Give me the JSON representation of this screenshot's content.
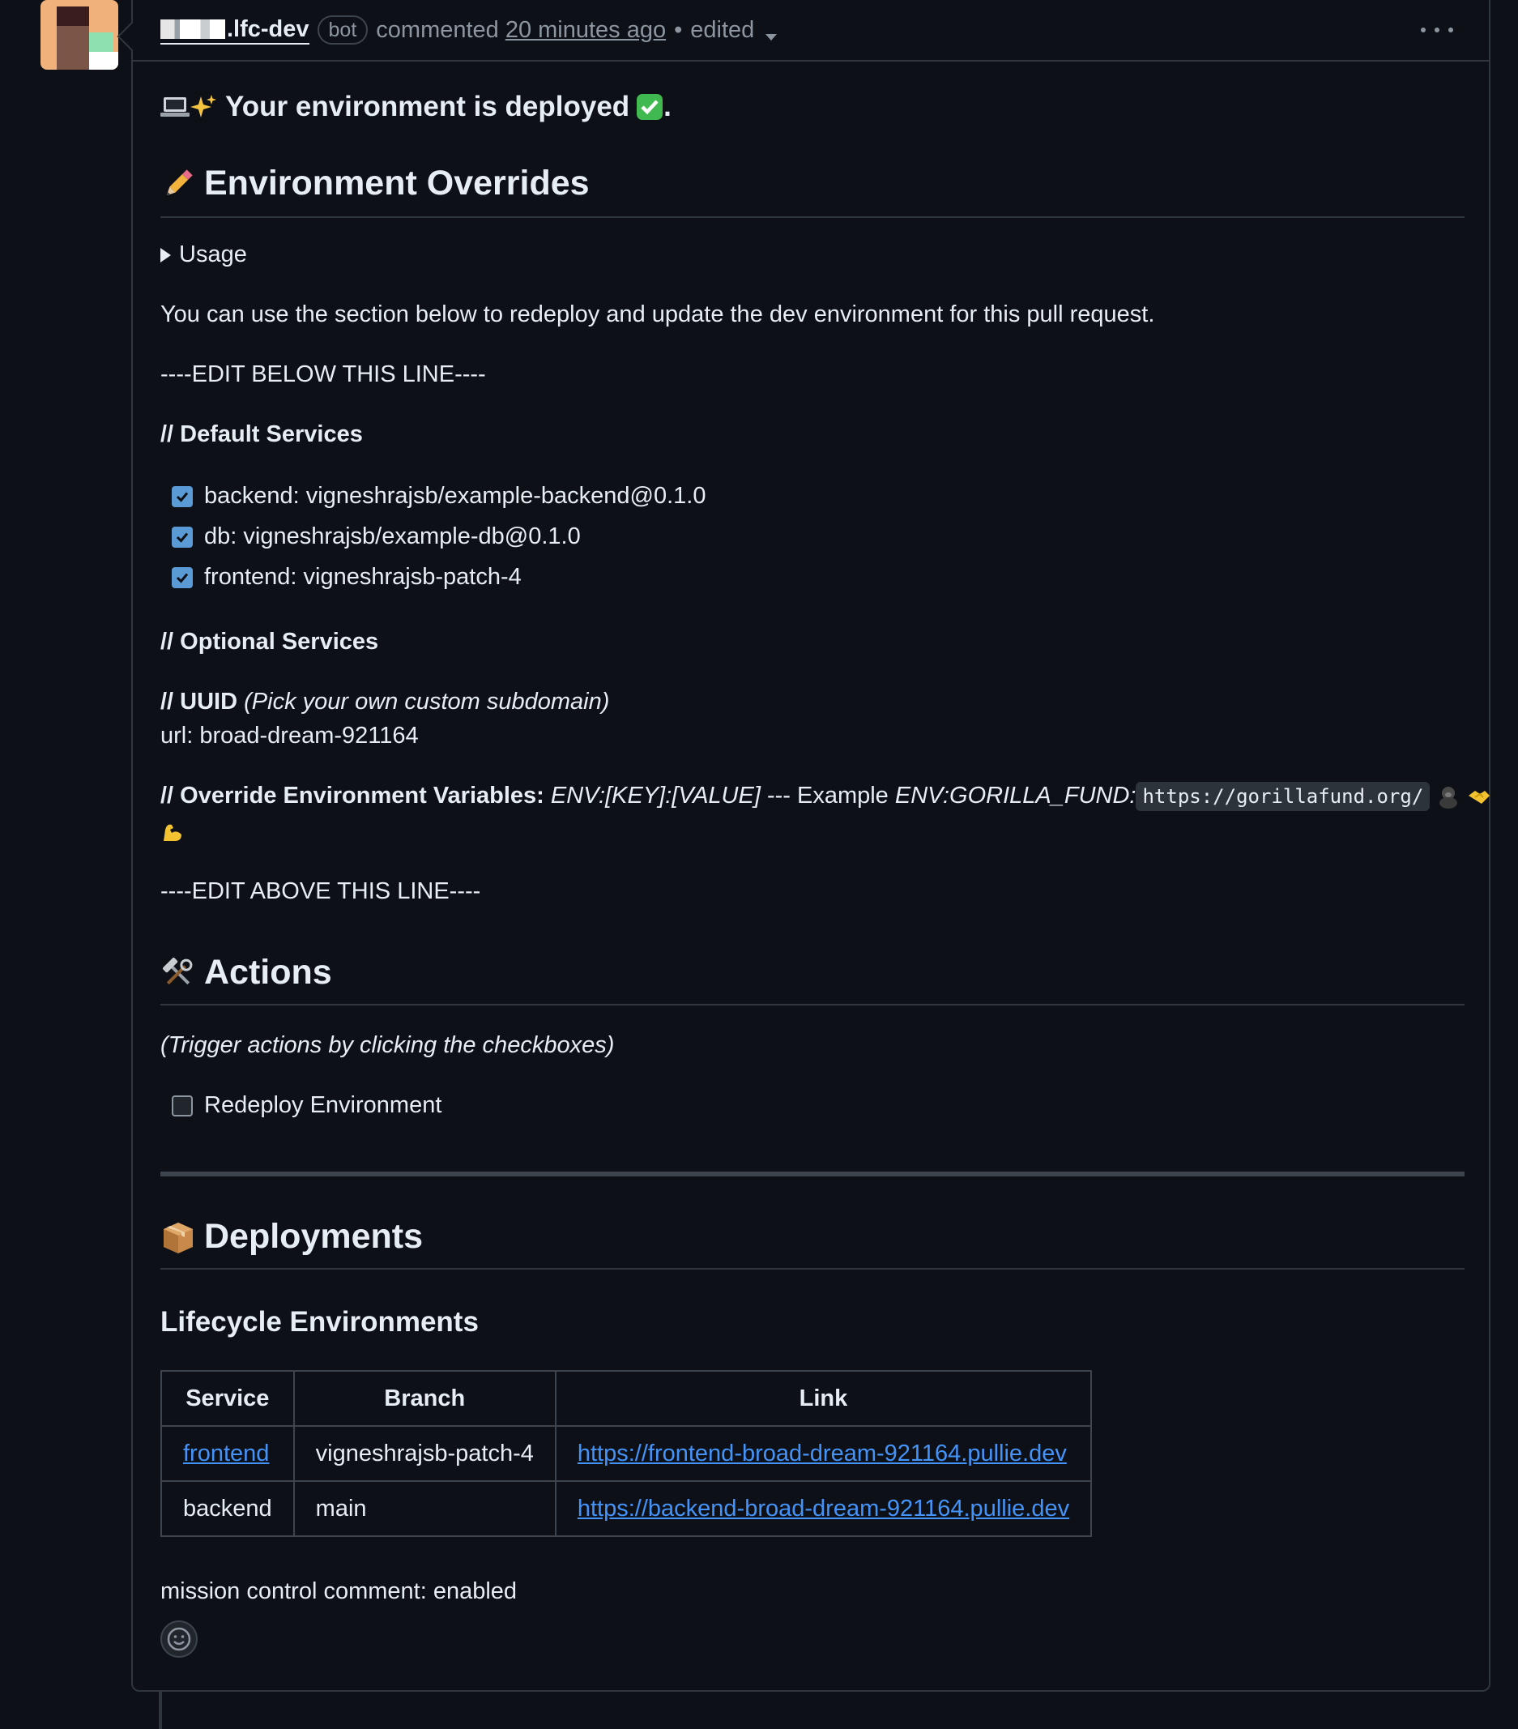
{
  "header": {
    "author": ".lfc-dev",
    "bot_badge": "bot",
    "action": "commented",
    "time": "20 minutes ago",
    "separator": "•",
    "edited": "edited"
  },
  "deployed_heading": "Your environment is deployed",
  "overrides": {
    "title": "Environment Overrides",
    "usage": "Usage",
    "intro": "You can use the section below to redeploy and update the dev environment for this pull request.",
    "edit_below": "----EDIT BELOW THIS LINE----",
    "default_services_label": "// Default Services",
    "default_services": [
      {
        "label": "backend: vigneshrajsb/example-backend@0.1.0",
        "checked": true
      },
      {
        "label": "db: vigneshrajsb/example-db@0.1.0",
        "checked": true
      },
      {
        "label": "frontend: vigneshrajsb-patch-4",
        "checked": true
      }
    ],
    "optional_services_label": "// Optional Services",
    "uuid_label": "// UUID",
    "uuid_hint": "(Pick your own custom subdomain)",
    "url_line": "url: broad-dream-921164",
    "override_label": "// Override Environment Variables:",
    "override_format": "ENV:[KEY]:[VALUE]",
    "override_sep": "--- Example",
    "override_example": "ENV:GORILLA_FUND:",
    "override_example_url": "https://gorillafund.org/",
    "edit_above": "----EDIT ABOVE THIS LINE----"
  },
  "actions": {
    "title": "Actions",
    "hint": "(Trigger actions by clicking the checkboxes)",
    "redeploy_label": "Redeploy Environment",
    "redeploy_checked": false
  },
  "deployments": {
    "title": "Deployments",
    "subtitle": "Lifecycle Environments",
    "columns": [
      "Service",
      "Branch",
      "Link"
    ],
    "rows": [
      {
        "service": "frontend",
        "branch": "vigneshrajsb-patch-4",
        "link": "https://frontend-broad-dream-921164.pullie.dev"
      },
      {
        "service": "backend",
        "branch": "main",
        "link": "https://backend-broad-dream-921164.pullie.dev"
      }
    ]
  },
  "footer_text": "mission control comment: enabled",
  "colors": {
    "background": "#0d1117",
    "border": "#30363d",
    "link": "#4493f8",
    "checkbox": "#5b9bd5",
    "muted": "#8d96a0"
  }
}
